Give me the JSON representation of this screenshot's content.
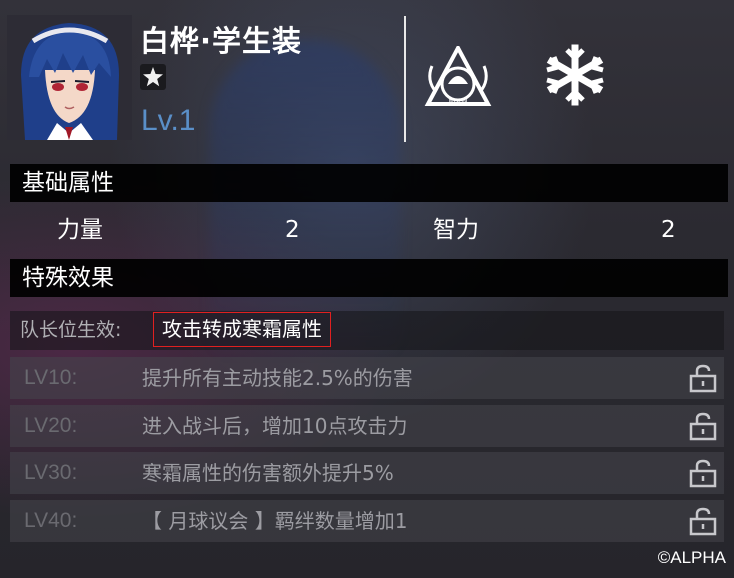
{
  "character": {
    "name": "白桦·学生装",
    "level": "Lv.1"
  },
  "sections": {
    "basic_attributes": "基础属性",
    "special_effects": "特殊效果"
  },
  "attributes": [
    {
      "label": "力量",
      "value": "2"
    },
    {
      "label": "智力",
      "value": "2"
    }
  ],
  "leader_effect": {
    "label": "队长位生效:",
    "effect": "攻击转成寒霜属性"
  },
  "level_effects": [
    {
      "level": "LV10:",
      "desc": "提升所有主动技能2.5%的伤害"
    },
    {
      "level": "LV20:",
      "desc": "进入战斗后，增加10点攻击力"
    },
    {
      "level": "LV30:",
      "desc": "寒霜属性的伤害额外提升5%"
    },
    {
      "level": "LV40:",
      "desc": "【 月球议会 】羁绊数量增加1"
    }
  ],
  "icons": {
    "faction": "moon-faction-icon",
    "faction_text": "MOON",
    "element": "frost-element-icon",
    "rarity": "star-icon",
    "lock": "lock-icon"
  },
  "colors": {
    "level_text": "#5a8fc8",
    "highlight_border": "#e02020"
  },
  "copyright": "©ALPHA"
}
